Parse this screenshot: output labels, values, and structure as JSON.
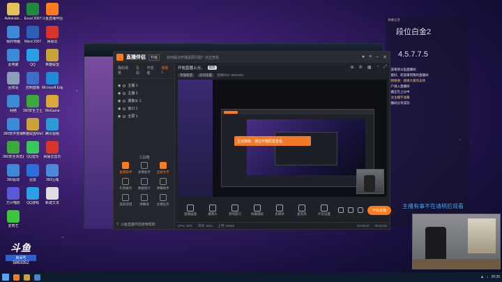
{
  "desktop": {
    "icons": [
      {
        "label": "Administr...",
        "color": "#e6c35a"
      },
      {
        "label": "Excel 2007",
        "color": "#1f8a3a"
      },
      {
        "label": "斗鱼直播伴侣",
        "color": "#ff7a1a"
      },
      {
        "label": "我的电脑",
        "color": "#3a8ad8"
      },
      {
        "label": "Word 2007",
        "color": "#2b5fb8"
      },
      {
        "label": "网易云",
        "color": "#d8342a"
      },
      {
        "label": "此电脑",
        "color": "#3a8ad8"
      },
      {
        "label": "QQ",
        "color": "#2aa0e8"
      },
      {
        "label": "英雄联盟",
        "color": "#c9a23a"
      },
      {
        "label": "回收站",
        "color": "#8aa0b8"
      },
      {
        "label": "控制面板",
        "color": "#3a70c8"
      },
      {
        "label": "Microsoft Edge",
        "color": "#1f8ad8"
      },
      {
        "label": "网络",
        "color": "#3a8ad8"
      },
      {
        "label": "360安全卫士",
        "color": "#3aa83a"
      },
      {
        "label": "WeGame",
        "color": "#d8a83a"
      },
      {
        "label": "360软件管家",
        "color": "#3a8ad8"
      },
      {
        "label": "英雄联盟WeGame",
        "color": "#c9a23a"
      },
      {
        "label": "腾讯视频",
        "color": "#2a9ad8"
      },
      {
        "label": "360安全浏览器",
        "color": "#3aa83a"
      },
      {
        "label": "QQ音乐",
        "color": "#3ac85a"
      },
      {
        "label": "网易云音乐",
        "color": "#d8342a"
      },
      {
        "label": "360驱动",
        "color": "#3a8ad8"
      },
      {
        "label": "迅雷",
        "color": "#2a70d8"
      },
      {
        "label": "360压缩",
        "color": "#4a8ad8"
      },
      {
        "label": "万兴喵影",
        "color": "#5a5ad8"
      },
      {
        "label": "QQ游戏",
        "color": "#2aa0e8"
      },
      {
        "label": "新建文本",
        "color": "#ddd"
      },
      {
        "label": "爱奇艺",
        "color": "#3ac83a"
      }
    ]
  },
  "app": {
    "name": "直播伴侣",
    "tag": "升级",
    "notice": "如何解决开播黑屏问题？点击查看",
    "sidebar": {
      "tabs": [
        "我的场景",
        "互动",
        "开发者",
        "场景1"
      ],
      "scenes": [
        "主播 1",
        "主播 2",
        "摄像头 1",
        "窗口 1",
        "全屏 1"
      ],
      "tools_title": "工具箱",
      "tools": [
        {
          "label": "直播助手",
          "hot": true
        },
        {
          "label": "录像助手",
          "hot": false
        },
        {
          "label": "全屏文字",
          "hot": true
        },
        {
          "label": "礼物展示",
          "hot": false
        },
        {
          "label": "数据统计",
          "hot": false
        },
        {
          "label": "弹幕助手",
          "hot": false
        },
        {
          "label": "美颜滤镜",
          "hot": false
        },
        {
          "label": "弹幕墙",
          "hot": false
        },
        {
          "label": "主播任务",
          "hot": false
        }
      ],
      "bottom": "斗鱼直播伴侣使用帮助"
    },
    "main": {
      "title": "开始直播上分。",
      "edit": "修改",
      "chips": [
        "英雄联盟",
        "房间设置"
      ],
      "meta": "直播间ID: 5863352"
    },
    "preview": {
      "toast": "互动弹窗：通过开播配置查看"
    },
    "bottom_tools": [
      "直播画面",
      "摄像头",
      "游戏窗口",
      "屏幕捕捉",
      "多媒体",
      "麦克风",
      "声音设置"
    ],
    "start_button": "开始直播",
    "status": {
      "left": "CPU: 18%",
      "mid1": "内存: 52%",
      "mid2": "上传: 0KB/s",
      "time1": "00:00:02",
      "time2": "00:00:00"
    }
  },
  "overlay": {
    "rank": "段位白金2",
    "version": "4.5.7.7.5",
    "chat_head": "弹幕信息",
    "chat_lines": [
      {
        "text": "欢迎来到斗鱼直播间",
        "warn": false
      },
      {
        "text": "大家好，欢迎来到我的直播间",
        "warn": false
      },
      {
        "text": "礼物感谢：感谢大家的支持",
        "warn": true
      },
      {
        "text": "用户进入直播间",
        "warn": false
      },
      {
        "text": "主播正在上分中",
        "warn": false
      },
      {
        "text": "关注主播不迷路",
        "warn": true
      },
      {
        "text": "直播间分享成功",
        "warn": false
      }
    ],
    "marquee": "主播有事不在请稍后观看"
  },
  "room": {
    "logo": "斗鱼",
    "label": "房间号",
    "number": "5863352"
  },
  "taskbar": {
    "clock": "20:35"
  }
}
